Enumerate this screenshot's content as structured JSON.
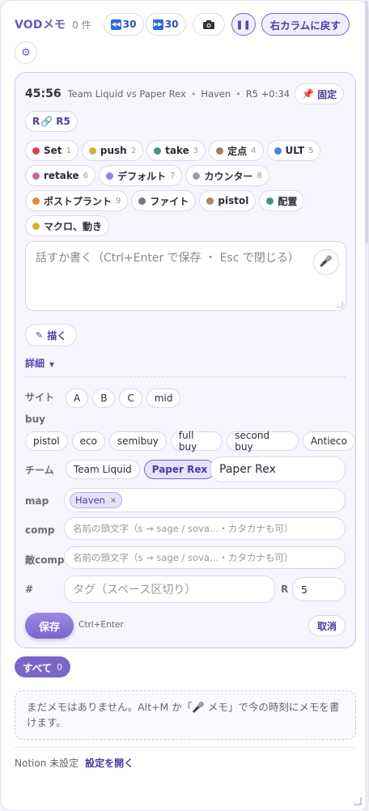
{
  "header": {
    "title": "VODメモ",
    "count": "0 件",
    "back_label": "30",
    "forward_label": "30",
    "right_column_label": "右カラムに戻す"
  },
  "editor": {
    "time": "45:56",
    "match": "Team Liquid vs Paper Rex",
    "map": "Haven",
    "round_offset": "R5 +0:34",
    "pin_label": "固定",
    "round_prefix": "R",
    "round_label": "R5",
    "tags": [
      {
        "label": "Set",
        "num": "1",
        "color": "#d9444a"
      },
      {
        "label": "push",
        "num": "2",
        "color": "#d8ad3a"
      },
      {
        "label": "take",
        "num": "3",
        "color": "#3a9a80"
      },
      {
        "label": "定点",
        "num": "4",
        "color": "#a0806a"
      },
      {
        "label": "ULT",
        "num": "5",
        "color": "#4a86d8"
      },
      {
        "label": "retake",
        "num": "6",
        "color": "#d4609a"
      },
      {
        "label": "デフォルト",
        "num": "7",
        "color": "#9b7fe0"
      },
      {
        "label": "カウンター",
        "num": "8",
        "color": "#a09aa8"
      },
      {
        "label": "ポストプラント",
        "num": "9",
        "color": "#e08a3a"
      },
      {
        "label": "ファイト",
        "num": "",
        "color": "#7a7688"
      },
      {
        "label": "pistol",
        "num": "",
        "color": "#a88866"
      },
      {
        "label": "配置",
        "num": "",
        "color": "#3a9a80"
      },
      {
        "label": "マクロ、動き",
        "num": "",
        "color": "#d8ad3a"
      }
    ],
    "note_placeholder": "話すか書く（Ctrl+Enter で保存 ・ Esc で閉じる）",
    "draw_label": "描く",
    "details_label": "詳細",
    "site_label": "サイト",
    "sites": [
      "A",
      "B",
      "C",
      "mid"
    ],
    "buy_label": "buy",
    "buys": [
      "pistol",
      "eco",
      "semibuy",
      "full buy",
      "second buy",
      "Antieco"
    ],
    "team_label": "チーム",
    "teams": [
      "Team Liquid",
      "Paper Rex"
    ],
    "team_value": "Paper Rex",
    "map_label": "map",
    "map_chip": "Haven",
    "comp_label": "comp",
    "comp_placeholder": "名前の頭文字（s → sage / sova…・カタカナも可）",
    "enemy_comp_label": "敵comp",
    "enemy_comp_placeholder": "名前の頭文字（s → sage / sova…・カタカナも可）",
    "hash_label": "#",
    "tag_placeholder": "タグ（スペース区切り）",
    "r_label": "R",
    "r_value": "5",
    "save_label": "保存",
    "save_hint": "Ctrl+Enter",
    "cancel_label": "取消"
  },
  "list": {
    "all_label": "すべて",
    "all_count": "0",
    "empty_message": "まだメモはありません。Alt+M か「🎤 メモ」で今の時刻にメモを書けます。"
  },
  "footer": {
    "notion_status": "Notion 未設定",
    "open_settings": "設定を開く"
  },
  "colors": {
    "accent": "#7b66c8",
    "accent_text": "#4d3c9e",
    "card_bg": "#f7f5fd"
  }
}
